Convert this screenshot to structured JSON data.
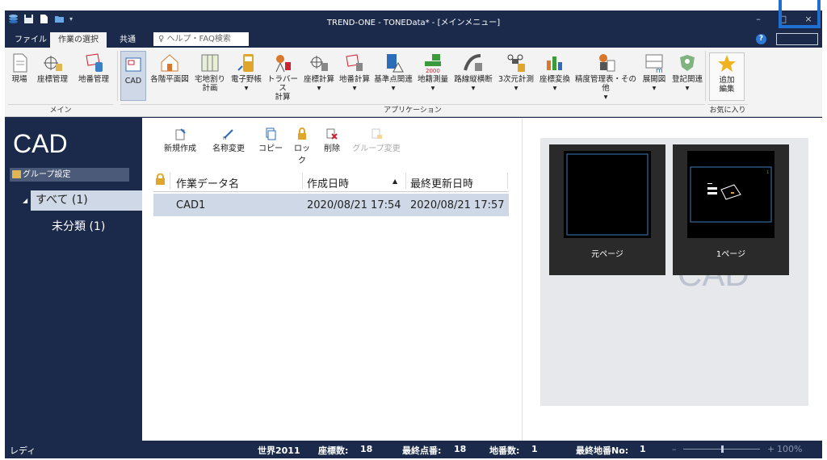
{
  "window": {
    "title": "TREND-ONE - TONEData* - [メインメニュー]",
    "minimize": "–",
    "maximize": "□",
    "close": "×"
  },
  "menu": {
    "file": "ファイル",
    "work_select": "作業の選択",
    "common": "共通",
    "help_placeholder": "ヘルプ・FAQ検索"
  },
  "ribbon": {
    "main_group": "メイン",
    "app_group": "アプリケーション",
    "fav_group": "お気に入り",
    "main_buttons": [
      "現場",
      "座標管理",
      "地番管理"
    ],
    "app_buttons": [
      {
        "l1": "CAD",
        "l2": ""
      },
      {
        "l1": "各階平面図",
        "l2": ""
      },
      {
        "l1": "宅地割り",
        "l2": "計画"
      },
      {
        "l1": "電子野帳",
        "l2": "▾"
      },
      {
        "l1": "トラバース",
        "l2": "計算"
      },
      {
        "l1": "座標計算",
        "l2": "▾"
      },
      {
        "l1": "地番計算",
        "l2": "▾"
      },
      {
        "l1": "基準点関連",
        "l2": "▾"
      },
      {
        "l1": "地籍測量",
        "l2": "▾"
      },
      {
        "l1": "路線縦横断",
        "l2": "▾"
      },
      {
        "l1": "3次元計測",
        "l2": "▾"
      },
      {
        "l1": "座標変換",
        "l2": "▾"
      },
      {
        "l1": "精度管理表・その他",
        "l2": "▾"
      },
      {
        "l1": "展開図",
        "l2": "▾"
      },
      {
        "l1": "登記関連",
        "l2": "▾"
      }
    ],
    "fav_button_l1": "追加",
    "fav_button_l2": "編集"
  },
  "sidebar": {
    "title": "CAD",
    "group_settings": "グループ設定",
    "tree_all": "すべて (1)",
    "tree_uncat": "未分類 (1)"
  },
  "toolbar": {
    "new": "新規作成",
    "rename": "名称変更",
    "copy": "コピー",
    "lock": "ロック",
    "delete": "削除",
    "group_change": "グループ変更"
  },
  "table": {
    "headers": [
      "作業データ名",
      "作成日時",
      "最終更新日時"
    ],
    "rows": [
      {
        "name": "CAD1",
        "created": "2020/08/21 17:54",
        "updated": "2020/08/21 17:57"
      }
    ]
  },
  "preview": {
    "watermark": "CAD",
    "thumb1_label": "元ページ",
    "thumb2_label": "1ページ"
  },
  "status": {
    "ready": "レディ",
    "system": "世界2011",
    "coord_count": "座標数:",
    "coord_count_val": "18",
    "last_point": "最終点番:",
    "last_point_val": "18",
    "lot_count": "地番数:",
    "lot_count_val": "1",
    "last_lot": "最終地番No:",
    "last_lot_val": "1",
    "zoom": "100%",
    "zoom_minus": "–",
    "zoom_plus": "+"
  },
  "colors": {
    "frame": "#1b2a4a",
    "selection": "#cfd8e6",
    "highlight_box": "#1e6fcf"
  }
}
